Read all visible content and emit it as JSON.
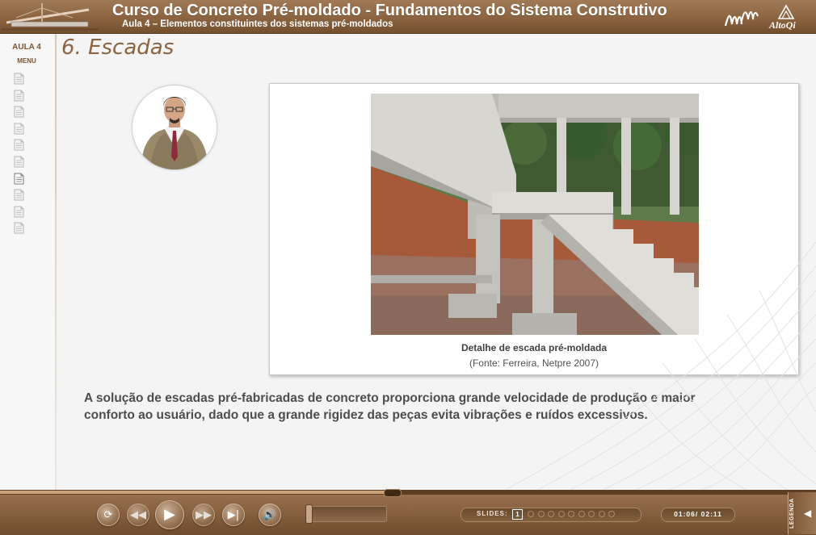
{
  "header": {
    "title": "Curso de Concreto Pré-moldado - Fundamentos do Sistema Construtivo",
    "subtitle": "Aula 4 – Elementos constituintes dos sistemas pré-moldados",
    "logo_text": "AltoQi"
  },
  "sidebar": {
    "aula": "AULA 4",
    "menu": "MENU",
    "pages": [
      {
        "icon": "page-icon",
        "active": false
      },
      {
        "icon": "page-icon",
        "active": false
      },
      {
        "icon": "page-icon",
        "active": false
      },
      {
        "icon": "page-icon",
        "active": false
      },
      {
        "icon": "page-icon",
        "active": false
      },
      {
        "icon": "page-icon",
        "active": false
      },
      {
        "icon": "page-icon",
        "active": true
      },
      {
        "icon": "page-icon",
        "active": false
      },
      {
        "icon": "page-icon",
        "active": false
      },
      {
        "icon": "page-icon",
        "active": false
      }
    ]
  },
  "main": {
    "section_title": "6. Escadas",
    "figure": {
      "caption": "Detalhe de escada pré-moldada",
      "source": "(Fonte: Ferreira, Netpre 2007)"
    },
    "body_lines": [
      "A solução de escadas pré-fabricadas de concreto proporciona grande velocidade de produção e  maior",
      "conforto ao usuário, dado que a grande rigidez das peças evita vibrações e ruídos excessivos."
    ]
  },
  "player": {
    "slides_label": "SLIDES:",
    "current_slide": "1",
    "slide_count": 9,
    "time_elapsed": "01:06",
    "time_separator": "/",
    "time_total": "02:11",
    "legenda_label": "LEGENDA",
    "progress_fraction": 0.48,
    "buttons": [
      "replay-icon",
      "rewind-icon",
      "play-icon",
      "fast-forward-icon",
      "skip-end-icon",
      "volume-icon"
    ]
  },
  "colors": {
    "brand_brown": "#8b6341",
    "title_brown": "#8b6341",
    "text_gray": "#4d4d4d"
  }
}
